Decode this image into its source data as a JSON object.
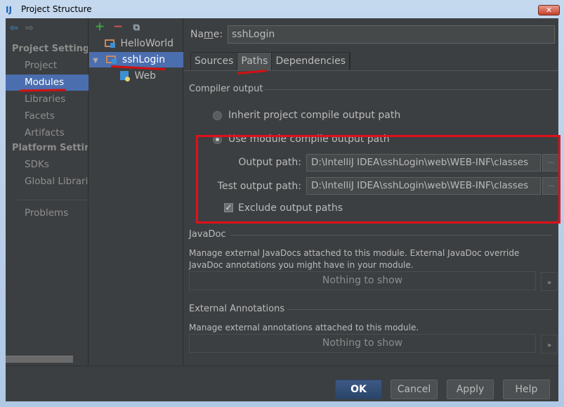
{
  "window": {
    "title": "Project Structure",
    "app_icon": "intellij-idea-icon",
    "close_label": "✕"
  },
  "sidebar": {
    "nav": {
      "back": "⇦",
      "forward": "⇨"
    },
    "sections": [
      {
        "title": "Project Settings",
        "items": [
          "Project",
          "Modules",
          "Libraries",
          "Facets",
          "Artifacts"
        ]
      },
      {
        "title": "Platform Settings",
        "items": [
          "SDKs",
          "Global Libraries"
        ]
      }
    ],
    "extra_items": [
      "Problems"
    ],
    "selected": "Modules"
  },
  "tree": {
    "toolbar": {
      "add": "+",
      "remove": "−",
      "copy": "⧉"
    },
    "rows": [
      {
        "label": "HelloWorld",
        "icon": "module-folder-icon",
        "selected": false
      },
      {
        "label": "sshLogin",
        "icon": "module-folder-icon",
        "selected": true,
        "expanded": true
      },
      {
        "label": "Web",
        "icon": "web-facet-icon",
        "selected": false
      }
    ]
  },
  "main": {
    "name_label": "Name:",
    "name_value": "sshLogin",
    "tabs": [
      "Sources",
      "Paths",
      "Dependencies"
    ],
    "active_tab": "Paths",
    "compiler_output": {
      "title": "Compiler output",
      "inherit_label": "Inherit project compile output path",
      "use_module_label": "Use module compile output path",
      "selected_option": "use_module",
      "output_path_label": "Output path:",
      "output_path_value": "D:\\IntelliJ IDEA\\sshLogin\\web\\WEB-INF\\classes",
      "test_output_path_label": "Test output path:",
      "test_output_path_value": "D:\\IntelliJ IDEA\\sshLogin\\web\\WEB-INF\\classes",
      "browse_label": "...",
      "exclude_label": "Exclude output paths",
      "exclude_checked": true
    },
    "javadoc": {
      "title": "JavaDoc",
      "description": "Manage external JavaDocs attached to this module. External JavaDoc override JavaDoc annotations you might have in your module.",
      "empty_text": "Nothing to show",
      "more_label": "»"
    },
    "external_annotations": {
      "title": "External Annotations",
      "description": "Manage external annotations attached to this module.",
      "empty_text": "Nothing to show",
      "more_label": "»"
    }
  },
  "footer": {
    "ok": "OK",
    "cancel": "Cancel",
    "apply": "Apply",
    "help": "Help"
  },
  "annotations": {
    "highlight_color": "#e0101a"
  }
}
